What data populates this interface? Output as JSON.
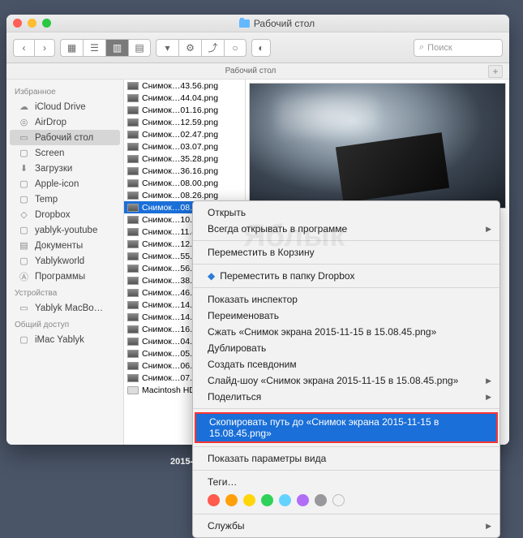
{
  "window": {
    "title": "Рабочий стол"
  },
  "search": {
    "placeholder": "Поиск"
  },
  "pathbar": {
    "label": "Рабочий стол"
  },
  "sidebar": {
    "sections": [
      {
        "header": "Избранное",
        "items": [
          {
            "icon": "cloud",
            "label": "iCloud Drive"
          },
          {
            "icon": "airdrop",
            "label": "AirDrop"
          },
          {
            "icon": "desktop",
            "label": "Рабочий стол",
            "selected": true
          },
          {
            "icon": "folder",
            "label": "Screen"
          },
          {
            "icon": "downloads",
            "label": "Загрузки"
          },
          {
            "icon": "folder",
            "label": "Apple-icon"
          },
          {
            "icon": "folder",
            "label": "Temp"
          },
          {
            "icon": "dropbox",
            "label": "Dropbox"
          },
          {
            "icon": "folder",
            "label": "yablyk-youtube"
          },
          {
            "icon": "documents",
            "label": "Документы"
          },
          {
            "icon": "folder",
            "label": "Yablykworld"
          },
          {
            "icon": "apps",
            "label": "Программы"
          }
        ]
      },
      {
        "header": "Устройства",
        "items": [
          {
            "icon": "laptop",
            "label": "Yablyk MacBo…"
          }
        ]
      },
      {
        "header": "Общий доступ",
        "items": [
          {
            "icon": "imac",
            "label": "iMac Yablyk"
          }
        ]
      }
    ]
  },
  "files": [
    "Снимок…43.56.png",
    "Снимок…44.04.png",
    "Снимок…01.16.png",
    "Снимок…12.59.png",
    "Снимок…02.47.png",
    "Снимок…03.07.png",
    "Снимок…35.28.png",
    "Снимок…36.16.png",
    "Снимок…08.00.png",
    "Снимок…08.26.png",
    "Снимок…08.45.png",
    "Снимок…10.46.png",
    "Снимок…11.49.png",
    "Снимок…12.19.png",
    "Снимок…55.22.png",
    "Снимок…56.19.png",
    "Снимок…38.04.png",
    "Снимок…46.40.png",
    "Снимок…14.00.png",
    "Снимок…14.23.png",
    "Снимок…16.31.png",
    "Снимок…04.47.png",
    "Снимок…05.57.png",
    "Снимок…06.04.png",
    "Снимок…07.24.png"
  ],
  "files_selected_index": 10,
  "disk_label": "Macintosh HD",
  "context_menu": {
    "open": "Открыть",
    "open_with": "Всегда открывать в программе",
    "trash": "Переместить в Корзину",
    "dropbox": "Переместить в папку Dropbox",
    "inspector": "Показать инспектор",
    "rename": "Переименовать",
    "compress": "Сжать «Снимок экрана 2015-11-15 в 15.08.45.png»",
    "duplicate": "Дублировать",
    "alias": "Создать псевдоним",
    "slideshow": "Слайд-шоу «Снимок экрана 2015-11-15 в 15.08.45.png»",
    "share": "Поделиться",
    "copy_path": "Скопировать путь до «Снимок экрана 2015-11-15 в 15.08.45.png»",
    "view_options": "Показать параметры вида",
    "tags_label": "Теги…",
    "services": "Службы"
  },
  "tags": [
    "#ff5a4d",
    "#ff9f0a",
    "#ffd60a",
    "#30d158",
    "#64d2ff",
    "#b06ef7",
    "#98989d"
  ],
  "footer": "2015-",
  "watermark": "Яблык"
}
